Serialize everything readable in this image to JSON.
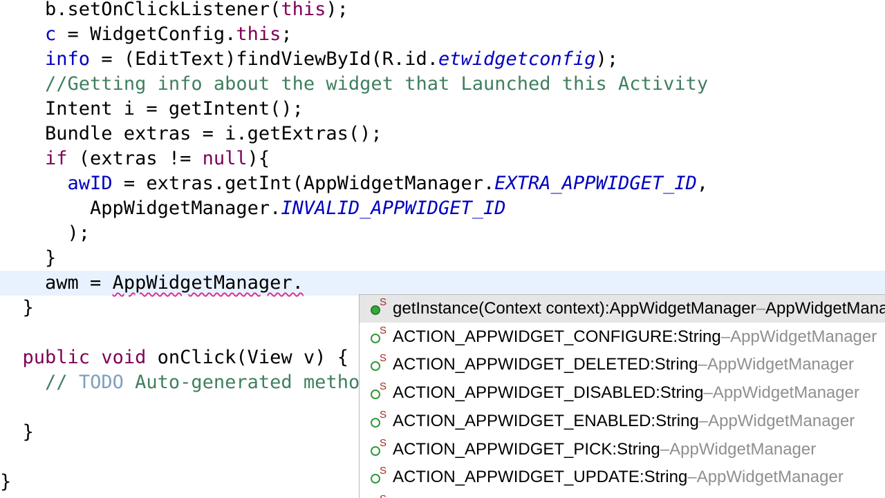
{
  "editor": {
    "lines": [
      {
        "segments": [
          {
            "t": "    b.setOnClickListener(",
            "c": ""
          },
          {
            "t": "this",
            "c": "kw"
          },
          {
            "t": ");",
            "c": ""
          }
        ]
      },
      {
        "segments": [
          {
            "t": "    ",
            "c": ""
          },
          {
            "t": "c",
            "c": "field"
          },
          {
            "t": " = WidgetConfig.",
            "c": ""
          },
          {
            "t": "this",
            "c": "kw"
          },
          {
            "t": ";",
            "c": ""
          }
        ]
      },
      {
        "segments": [
          {
            "t": "    ",
            "c": ""
          },
          {
            "t": "info",
            "c": "field"
          },
          {
            "t": " = (EditText)findViewById(R.id.",
            "c": ""
          },
          {
            "t": "etwidgetconfig",
            "c": "static"
          },
          {
            "t": ");",
            "c": ""
          }
        ]
      },
      {
        "segments": [
          {
            "t": "    ",
            "c": ""
          },
          {
            "t": "//Getting info about the widget that Launched this Activity",
            "c": "comment"
          }
        ]
      },
      {
        "segments": [
          {
            "t": "    Intent i = getIntent();",
            "c": ""
          }
        ]
      },
      {
        "segments": [
          {
            "t": "    Bundle extras = i.getExtras();",
            "c": ""
          }
        ]
      },
      {
        "segments": [
          {
            "t": "    ",
            "c": ""
          },
          {
            "t": "if",
            "c": "kw"
          },
          {
            "t": " (extras != ",
            "c": ""
          },
          {
            "t": "null",
            "c": "kw"
          },
          {
            "t": "){",
            "c": ""
          }
        ]
      },
      {
        "segments": [
          {
            "t": "      ",
            "c": ""
          },
          {
            "t": "awID",
            "c": "field"
          },
          {
            "t": " = extras.getInt(AppWidgetManager.",
            "c": ""
          },
          {
            "t": "EXTRA_APPWIDGET_ID",
            "c": "static"
          },
          {
            "t": ",",
            "c": ""
          }
        ]
      },
      {
        "segments": [
          {
            "t": "        AppWidgetManager.",
            "c": ""
          },
          {
            "t": "INVALID_APPWIDGET_ID",
            "c": "static"
          }
        ]
      },
      {
        "segments": [
          {
            "t": "      );",
            "c": ""
          }
        ]
      },
      {
        "segments": [
          {
            "t": "    }",
            "c": ""
          }
        ]
      },
      {
        "current": true,
        "segments": [
          {
            "t": "    awm = ",
            "c": ""
          },
          {
            "t": "AppWidgetManager.",
            "c": "squiggle"
          }
        ]
      },
      {
        "segments": [
          {
            "t": "  }",
            "c": ""
          }
        ]
      },
      {
        "segments": [
          {
            "t": "",
            "c": ""
          }
        ]
      },
      {
        "segments": [
          {
            "t": "  ",
            "c": ""
          },
          {
            "t": "public",
            "c": "kw"
          },
          {
            "t": " ",
            "c": ""
          },
          {
            "t": "void",
            "c": "kw"
          },
          {
            "t": " onClick(View v) {",
            "c": ""
          }
        ]
      },
      {
        "segments": [
          {
            "t": "    ",
            "c": ""
          },
          {
            "t": "// ",
            "c": "comment"
          },
          {
            "t": "TODO",
            "c": "todo"
          },
          {
            "t": " Auto-generated method stub",
            "c": "comment"
          }
        ]
      },
      {
        "segments": [
          {
            "t": "",
            "c": ""
          }
        ]
      },
      {
        "segments": [
          {
            "t": "  }",
            "c": ""
          }
        ]
      },
      {
        "segments": [
          {
            "t": "",
            "c": ""
          }
        ]
      },
      {
        "segments": [
          {
            "t": "}",
            "c": ""
          }
        ]
      }
    ]
  },
  "autocomplete": {
    "items": [
      {
        "name": "getInstance(Context context)",
        "type": "AppWidgetManager",
        "owner": "AppWidgetManager",
        "icon": "public-static-method-icon",
        "filled": true,
        "selected": true
      },
      {
        "name": "ACTION_APPWIDGET_CONFIGURE",
        "type": "String",
        "owner": "AppWidgetManager",
        "icon": "public-static-field-icon",
        "filled": false,
        "selected": false
      },
      {
        "name": "ACTION_APPWIDGET_DELETED",
        "type": "String",
        "owner": "AppWidgetManager",
        "icon": "public-static-field-icon",
        "filled": false,
        "selected": false
      },
      {
        "name": "ACTION_APPWIDGET_DISABLED",
        "type": "String",
        "owner": "AppWidgetManager",
        "icon": "public-static-field-icon",
        "filled": false,
        "selected": false
      },
      {
        "name": "ACTION_APPWIDGET_ENABLED",
        "type": "String",
        "owner": "AppWidgetManager",
        "icon": "public-static-field-icon",
        "filled": false,
        "selected": false
      },
      {
        "name": "ACTION_APPWIDGET_PICK",
        "type": "String",
        "owner": "AppWidgetManager",
        "icon": "public-static-field-icon",
        "filled": false,
        "selected": false
      },
      {
        "name": "ACTION_APPWIDGET_UPDATE",
        "type": "String",
        "owner": "AppWidgetManager",
        "icon": "public-static-field-icon",
        "filled": false,
        "selected": false
      },
      {
        "name": "",
        "type": "",
        "owner": "",
        "icon": "public-static-field-icon",
        "filled": false,
        "selected": false
      }
    ],
    "type_separator": " : ",
    "owner_separator": " – ",
    "static_marker": "S"
  }
}
